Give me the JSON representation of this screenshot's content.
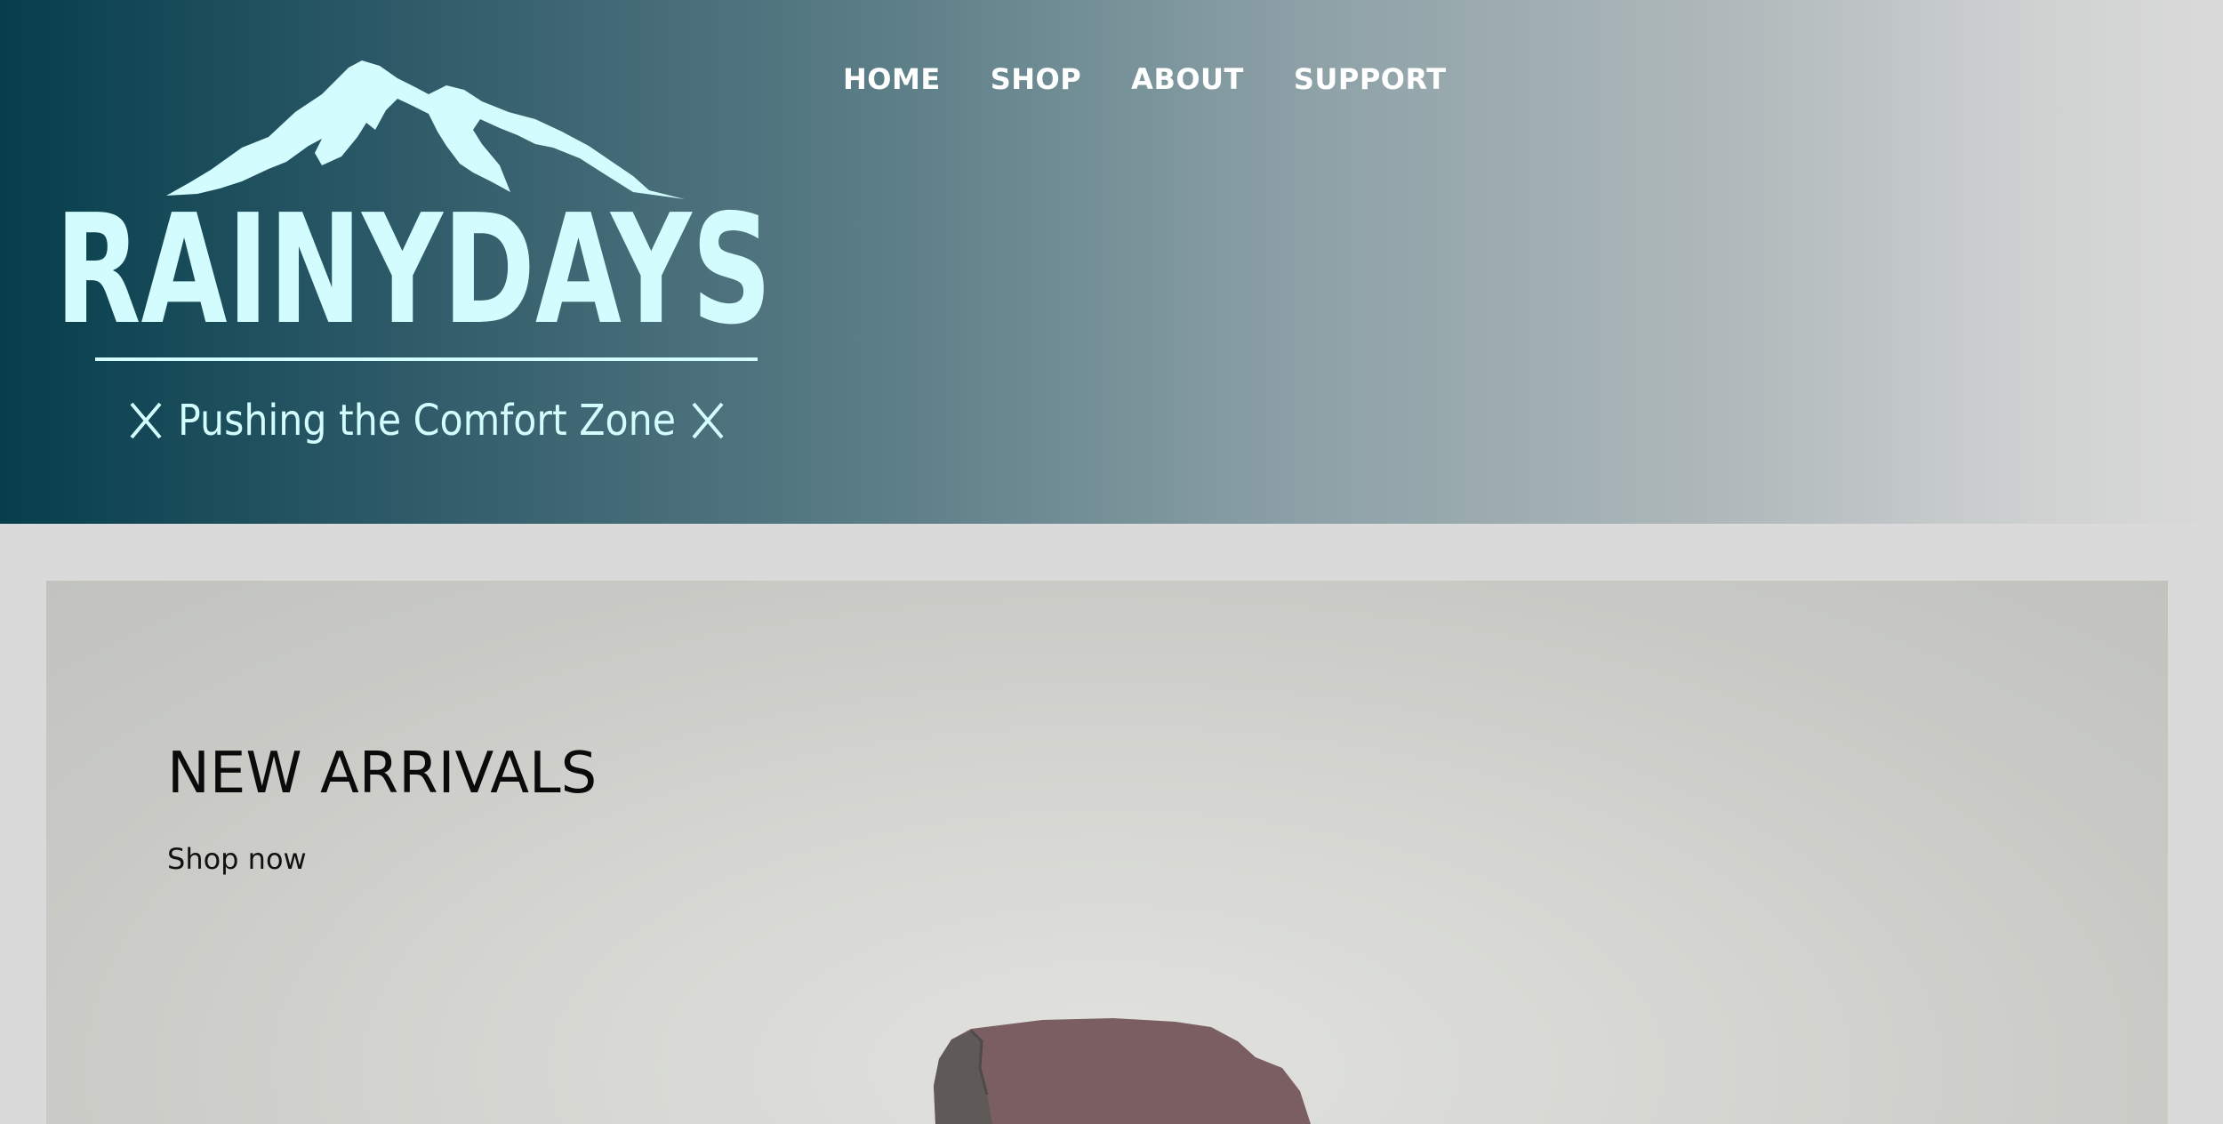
{
  "brand": {
    "name": "RAINYDAYS",
    "tagline": "Pushing the Comfort Zone",
    "logo_color": "#d3fcff"
  },
  "nav": {
    "items": [
      {
        "label": "HOME"
      },
      {
        "label": "SHOP"
      },
      {
        "label": "ABOUT"
      },
      {
        "label": "SUPPORT"
      }
    ]
  },
  "hero": {
    "title": "NEW ARRIVALS",
    "cta": "Shop now",
    "jacket_color": "#7a5e62"
  },
  "colors": {
    "header_dark": "#063e4c",
    "header_light": "#dadada",
    "page_bg": "#dadada"
  }
}
